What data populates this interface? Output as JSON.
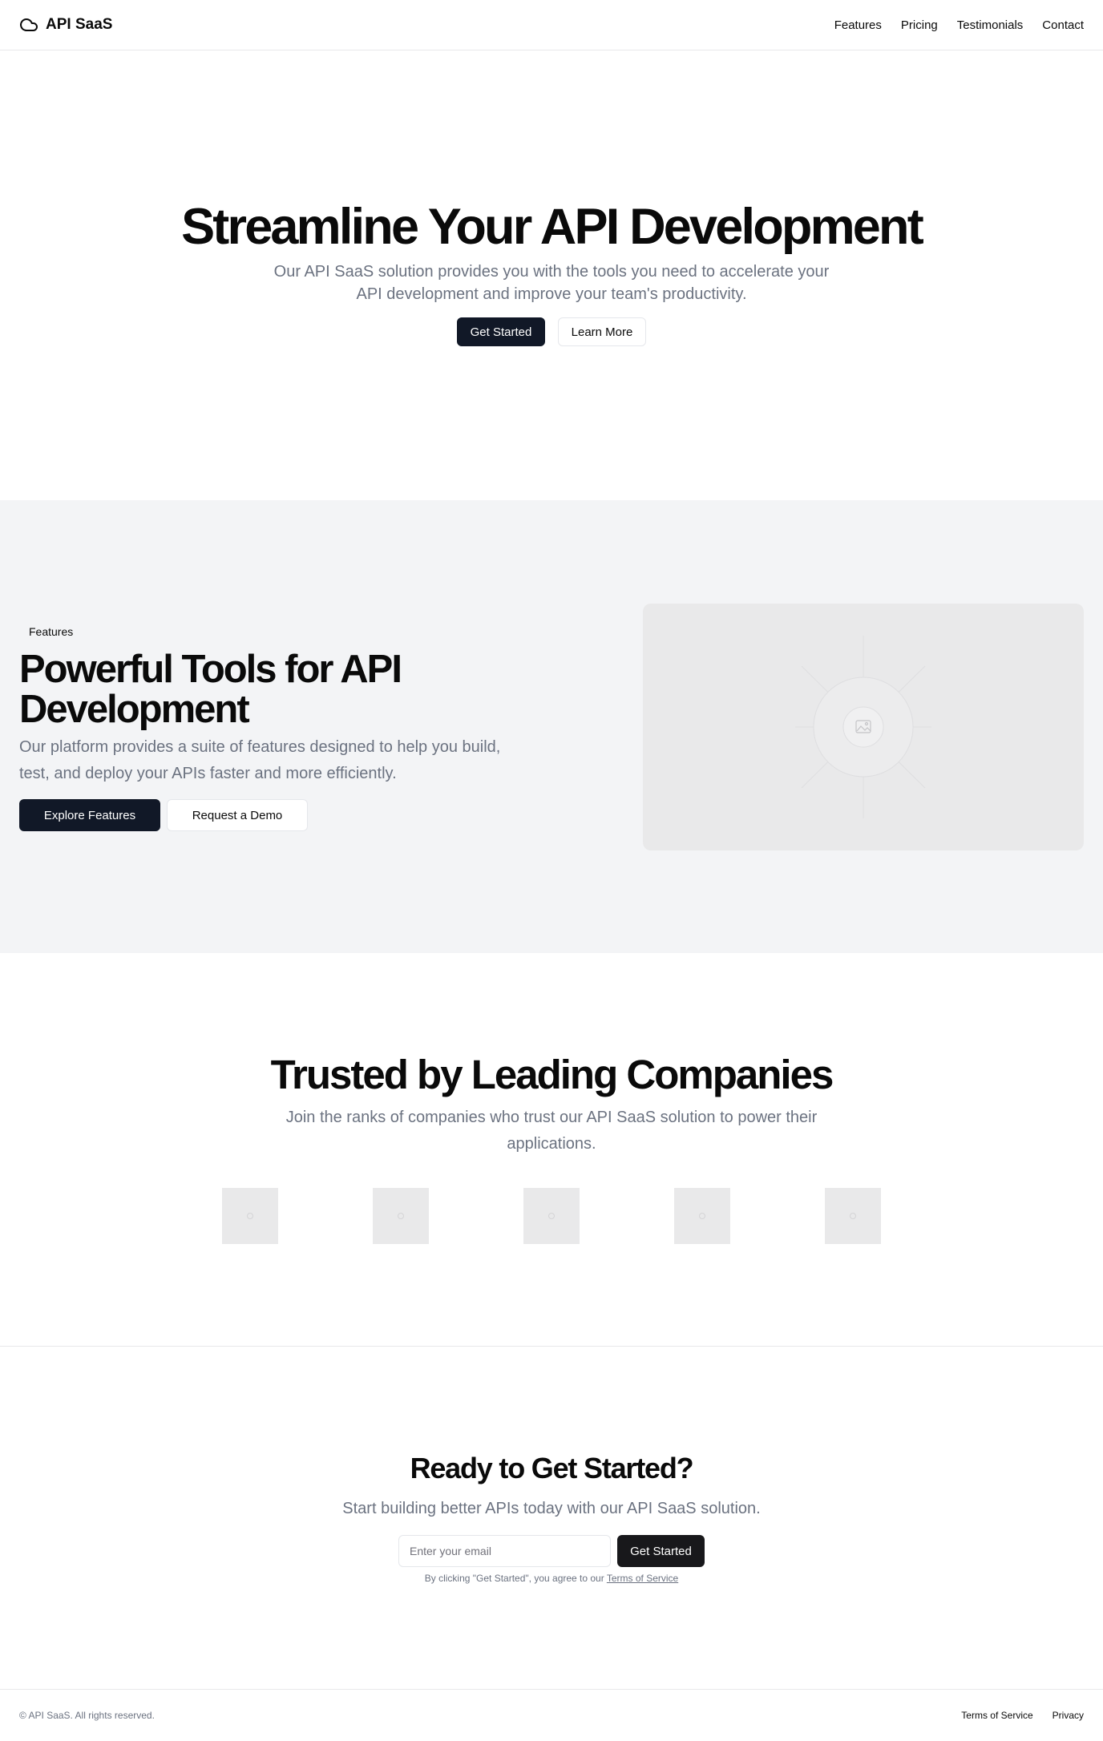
{
  "header": {
    "brand": "API SaaS",
    "brand_icon": "cloud-icon",
    "nav": [
      "Features",
      "Pricing",
      "Testimonials",
      "Contact"
    ]
  },
  "hero": {
    "title": "Streamline Your API Development",
    "description": "Our API SaaS solution provides you with the tools you need to accelerate your API development and improve your team's productivity.",
    "primary_button": "Get Started",
    "secondary_button": "Learn More"
  },
  "features": {
    "tag": "Features",
    "title": "Powerful Tools for API Development",
    "description": "Our platform provides a suite of features designed to help you build, test, and deploy your APIs faster and more efficiently.",
    "primary_button": "Explore Features",
    "secondary_button": "Request a Demo",
    "image_icon": "image-placeholder-icon"
  },
  "trusted": {
    "title": "Trusted by Leading Companies",
    "description": "Join the ranks of companies who trust our API SaaS solution to power their applications.",
    "logo_count": 5
  },
  "cta": {
    "title": "Ready to Get Started?",
    "description": "Start building better APIs today with our API SaaS solution.",
    "email_placeholder": "Enter your email",
    "email_value": "",
    "button": "Get Started",
    "note_prefix": "By clicking \"Get Started\", you agree to our ",
    "note_link": "Terms of Service"
  },
  "footer": {
    "copyright": "© API SaaS. All rights reserved.",
    "links": [
      "Terms of Service",
      "Privacy"
    ]
  },
  "colors": {
    "primary_button": "#111827",
    "cta_button": "#18181b",
    "muted_text": "#6b7280",
    "section_bg": "#f3f4f6",
    "placeholder_bg": "#e9e9ea"
  }
}
